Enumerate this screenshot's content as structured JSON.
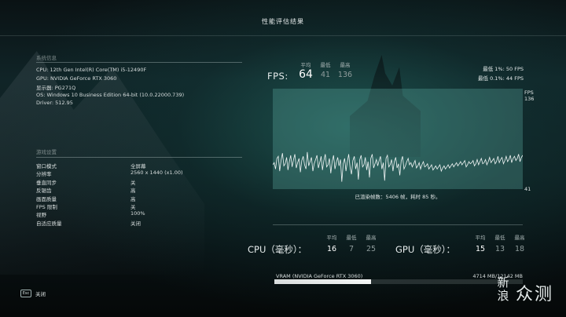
{
  "header": {
    "title": "性能评估结果"
  },
  "system": {
    "heading": "系统信息",
    "cpu": "CPU:  12th Gen Intel(R) Core(TM) i5-12490F",
    "gpu": "GPU:  NVIDIA GeForce RTX 3060",
    "monitor": "显示器:  PG271Q",
    "os": "OS: Windows 10 Business Edition 64-bit (10.0.22000.739)",
    "driver": "Driver: 512.95"
  },
  "settings": {
    "heading": "游戏设置",
    "rows": [
      {
        "label": "窗口模式",
        "value": "全屏幕"
      },
      {
        "label": "分辨率",
        "value": "2560 x 1440 (x1.00)"
      },
      {
        "label": "垂直同步",
        "value": "关"
      },
      {
        "label": "反锯齿",
        "value": "高"
      },
      {
        "label": "画面质量",
        "value": "高"
      },
      {
        "label": "FPS 限制",
        "value": "关"
      },
      {
        "label": "视野",
        "value": "100%"
      },
      {
        "label": "自适应质量",
        "value": "关闭"
      }
    ]
  },
  "fps": {
    "label": "FPS:",
    "col_avg": "平均",
    "col_min": "最低",
    "col_max": "最高",
    "avg": "64",
    "min": "41",
    "max": "136",
    "low1_label": "最低 1%:",
    "low1_value": "50 FPS",
    "low01_label": "最低 0.1%:",
    "low01_value": "44 FPS",
    "axis_top_1": "FPS",
    "axis_top_2": "136",
    "axis_bottom": "41",
    "rendered": "已渲染帧数：5406 帧，耗时 85 秒。"
  },
  "chart_data": {
    "type": "line",
    "ylim": [
      41,
      136
    ],
    "series": [
      {
        "values": [
          64,
          66,
          60,
          70,
          72,
          58,
          68,
          75,
          63,
          65,
          71,
          59,
          67,
          73,
          62,
          69,
          74,
          61,
          66,
          70,
          57,
          68,
          72,
          64,
          60,
          76,
          63,
          67,
          71,
          58,
          65,
          69,
          73,
          61,
          66,
          72,
          59,
          68,
          74,
          62,
          64,
          70,
          56,
          67,
          73,
          60,
          66,
          71,
          63,
          69,
          48,
          65,
          70,
          58,
          67,
          74,
          61,
          55,
          68,
          72,
          60,
          66,
          50,
          69,
          73,
          62,
          64,
          71,
          59,
          67,
          52,
          70,
          74,
          61,
          65,
          69,
          63,
          68,
          72,
          60,
          66,
          49,
          70,
          73,
          62,
          64,
          69,
          58,
          67,
          71,
          61,
          65,
          54,
          68,
          72,
          60,
          63,
          67,
          70,
          64,
          66,
          62,
          65,
          68,
          61,
          63,
          66,
          60,
          64,
          67,
          62,
          63,
          65,
          60,
          62,
          64,
          59,
          61,
          63,
          60,
          62,
          64,
          58,
          61,
          63,
          60,
          62,
          64,
          61,
          63,
          65,
          62,
          64,
          66,
          63,
          65,
          67,
          64,
          66,
          68,
          62,
          64,
          67,
          65,
          66,
          68,
          63,
          65,
          69,
          64,
          67,
          70,
          65,
          66,
          69,
          64,
          67,
          71,
          66,
          68,
          70,
          65,
          67,
          72,
          66,
          69,
          71,
          65,
          68,
          72,
          67,
          69,
          73,
          66,
          70,
          72,
          68,
          70,
          74,
          67,
          71,
          73
        ]
      }
    ]
  },
  "cpu": {
    "label": "CPU（毫秒）：",
    "col_avg": "平均",
    "col_min": "最低",
    "col_max": "最高",
    "avg": "16",
    "min": "7",
    "max": "25"
  },
  "gpu": {
    "label": "GPU（毫秒）：",
    "col_avg": "平均",
    "col_min": "最低",
    "col_max": "最高",
    "avg": "15",
    "min": "13",
    "max": "18"
  },
  "vram": {
    "label": "VRAM (NVIDIA GeForce RTX 3060)",
    "value": "4714 MB/12142 MB",
    "used_mb": 4714,
    "total_mb": 12142
  },
  "footer": {
    "esc_key": "Esc",
    "close_label": "关闭"
  },
  "watermark": {
    "text_a": "新浪",
    "text_b": "众测"
  }
}
